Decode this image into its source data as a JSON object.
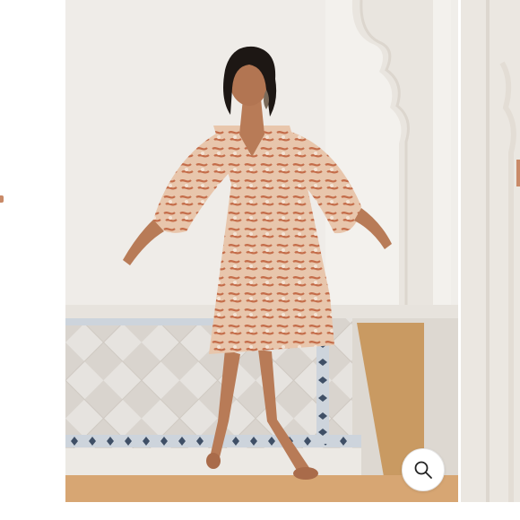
{
  "gallery": {
    "main_image": {
      "alt": ""
    },
    "next_image": {
      "alt": ""
    },
    "zoom_button": {
      "icon": "magnifier-icon",
      "label": ""
    }
  },
  "colors": {
    "dress_base": "#e7c2a8",
    "dress_print": "#c46d4a",
    "wall": "#efece8",
    "marble": "#e2dfdb",
    "border_tile": "#3f4f66",
    "wood_floor": "#c99a62"
  }
}
